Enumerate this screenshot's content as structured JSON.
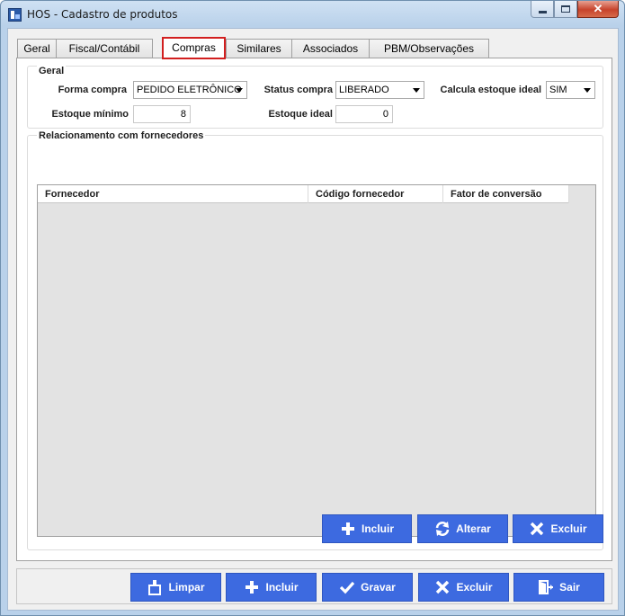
{
  "window": {
    "title": "HOS - Cadastro de produtos"
  },
  "tabs": [
    {
      "label": "Geral"
    },
    {
      "label": "Fiscal/Contábil"
    },
    {
      "label": "Compras"
    },
    {
      "label": "Similares"
    },
    {
      "label": "Associados"
    },
    {
      "label": "PBM/Observações"
    }
  ],
  "active_tab": "Compras",
  "geral": {
    "title": "Geral",
    "forma_compra": {
      "label": "Forma compra",
      "value": "PEDIDO ELETRÔNICO"
    },
    "status_compra": {
      "label": "Status compra",
      "value": "LIBERADO"
    },
    "calcula_estoque": {
      "label": "Calcula estoque ideal",
      "value": "SIM"
    },
    "estoque_minimo": {
      "label": "Estoque mínimo",
      "value": "8"
    },
    "estoque_ideal": {
      "label": "Estoque ideal",
      "value": "0"
    }
  },
  "fornecedores": {
    "title": "Relacionamento com fornecedores",
    "columns": [
      "Fornecedor",
      "Código fornecedor",
      "Fator de conversão"
    ],
    "rows": [],
    "buttons": {
      "incluir": "Incluir",
      "alterar": "Alterar",
      "excluir": "Excluir"
    }
  },
  "footer": {
    "limpar": "Limpar",
    "incluir": "Incluir",
    "gravar": "Gravar",
    "excluir": "Excluir",
    "sair": "Sair"
  },
  "colors": {
    "accent_button": "#3d6ae0",
    "active_tab_border": "#d21f1f"
  },
  "icons": {
    "limpar": "broom-icon",
    "incluir": "plus-icon",
    "gravar": "check-icon",
    "excluir": "x-icon",
    "sair": "exit-door-icon",
    "alterar": "refresh-icon"
  }
}
